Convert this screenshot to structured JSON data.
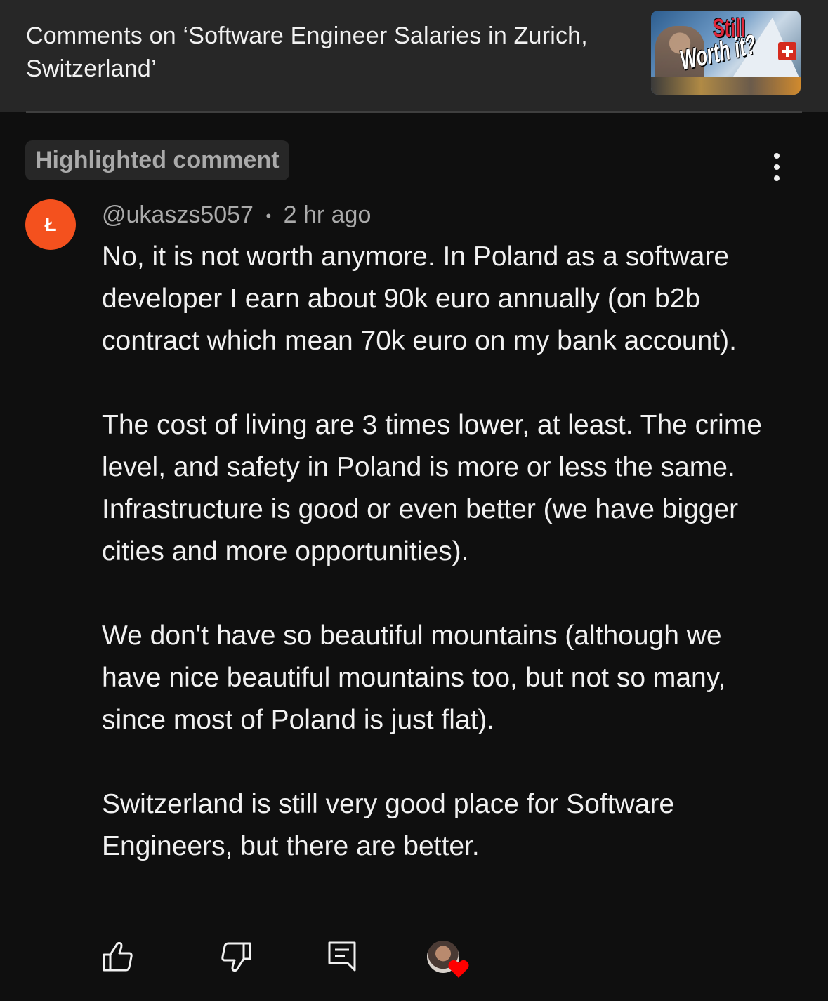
{
  "header": {
    "title": "Comments on ‘Software Engineer Salaries in Zurich, Switzerland’",
    "thumbnail": {
      "text_line1": "Still",
      "text_line2": "Worth it?"
    }
  },
  "badge": {
    "label": "Highlighted comment"
  },
  "comment": {
    "avatar_letter": "Ł",
    "avatar_color": "#f4511e",
    "author": "@ukaszs5057",
    "separator": "•",
    "time": "2 hr ago",
    "paragraphs": [
      "No, it is not worth anymore. In Poland as a software developer I earn about 90k euro annually (on b2b contract which mean 70k euro on my bank account).",
      "The cost of living are 3 times lower, at least. The crime level, and safety in Poland is more or less the same. Infrastructure is good or even better (we have bigger cities and more opportunities).",
      "We don't have so beautiful mountains (although we have nice beautiful mountains too, but not so many, since most of Poland is just flat).",
      "Switzerland is still very good place for Software Engineers, but there are better."
    ]
  },
  "actions": {
    "like_icon": "thumbs-up-icon",
    "dislike_icon": "thumbs-down-icon",
    "reply_icon": "reply-icon",
    "creator_heart_icon": "heart-icon",
    "heart_color": "#ff0000"
  }
}
